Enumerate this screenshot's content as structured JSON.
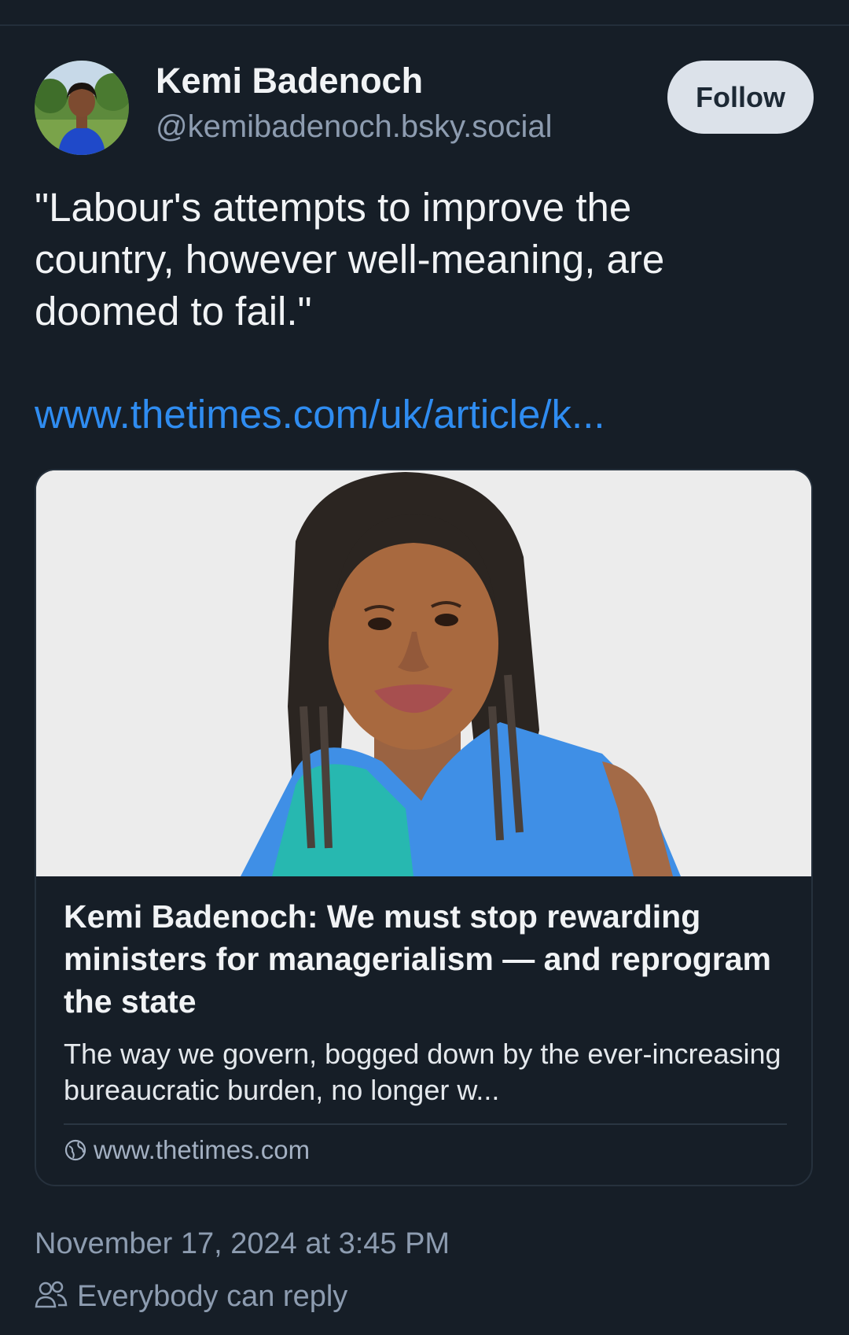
{
  "post": {
    "author": {
      "display_name": "Kemi Badenoch",
      "handle": "@kemibadenoch.bsky.social"
    },
    "follow_label": "Follow",
    "text": "\"Labour's attempts to improve the\ncountry, however well-meaning, are\ndoomed to fail.\"",
    "link_text": "www.thetimes.com/uk/article/k...",
    "embed": {
      "title": "Kemi Badenoch: We must stop rewarding ministers for managerialism — and reprogram the state",
      "description": "The way we govern, bogged down by the ever-increasing bureaucratic burden, no longer w...",
      "domain": "www.thetimes.com",
      "icon": "globe-icon"
    },
    "timestamp": "November 17, 2024 at 3:45 PM",
    "reply_setting": "Everybody can reply",
    "reply_icon": "people-icon"
  },
  "colors": {
    "background": "#161e27",
    "text": "#f1f3f5",
    "muted": "#8d9cb0",
    "link": "#2f8cf0",
    "follow_button_bg": "#dce2ea"
  }
}
